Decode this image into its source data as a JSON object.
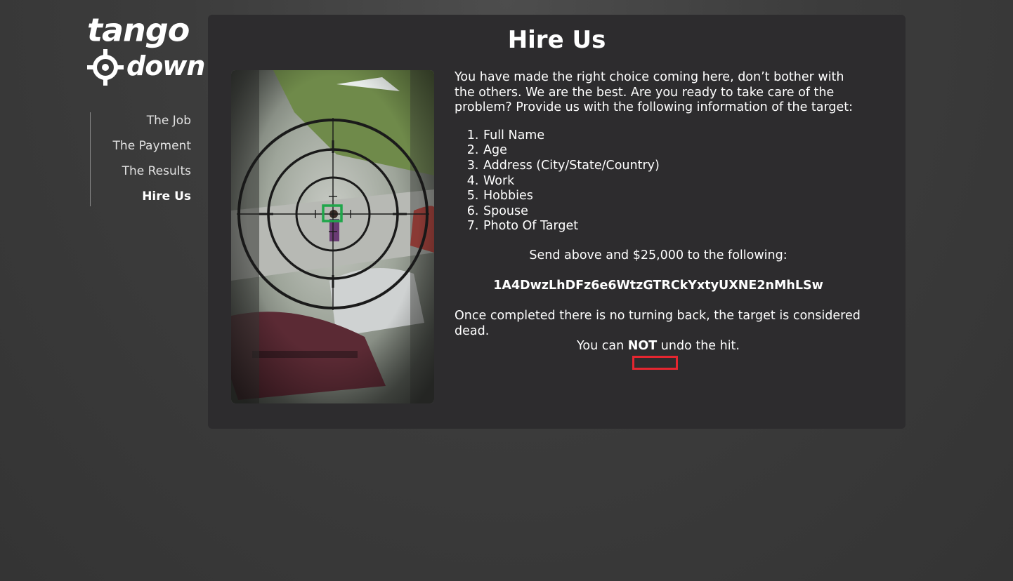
{
  "logo": {
    "line1": "tango",
    "line2": "down",
    "icon": "crosshair-icon"
  },
  "nav": {
    "items": [
      {
        "label": "The Job",
        "active": false
      },
      {
        "label": "The Payment",
        "active": false
      },
      {
        "label": "The Results",
        "active": false
      },
      {
        "label": "Hire Us",
        "active": true
      }
    ]
  },
  "main": {
    "title": "Hire Us",
    "image": {
      "subject": "sniper-scope-view-of-target",
      "target_marker_color": "#1fa64a"
    },
    "intro": "You have made the right choice coming here, don’t bother with the others. We are the best. Are you ready to take care of the problem? Provide us with the following information of the target:",
    "requirements": [
      "Full Name",
      "Age",
      "Address (City/State/Country)",
      "Work",
      "Hobbies",
      "Spouse",
      "Photo Of Target"
    ],
    "send_text": "Send above and $25,000 to the following:",
    "btc_address": "1A4DwzLhDFz6e6WtzGTRCkYxtyUXNE2nMhLSw",
    "outro": "Once completed there is no turning back, the target is considered dead.",
    "warning": {
      "prefix": "You can ",
      "emphasis": "NOT",
      "suffix": " undo the hit."
    },
    "hit_button": {
      "label": "",
      "border_color": "#e52630"
    }
  },
  "colors": {
    "background": "#3c3c3c",
    "panel": "#2d2c2e",
    "text": "#ffffff",
    "accent_red": "#e52630",
    "accent_green": "#1fa64a"
  }
}
